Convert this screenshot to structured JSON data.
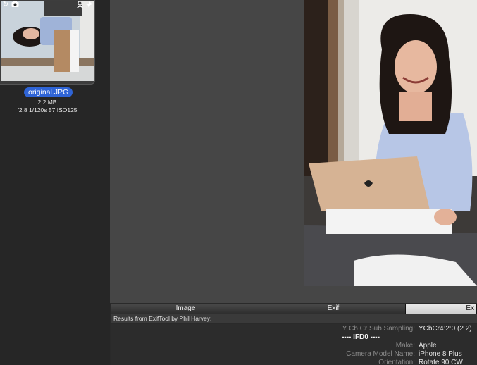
{
  "sidebar": {
    "file_name": "original.JPG",
    "file_size": "2.2 MB",
    "exposure": "f2.8 1/120s 57 ISO125",
    "thumb_icons": [
      "rotate-icon",
      "camera-icon",
      "person-icon",
      "pin-icon"
    ]
  },
  "tabs": [
    {
      "label": "Image"
    },
    {
      "label": "Exif"
    },
    {
      "label": "Ex"
    }
  ],
  "results": {
    "header": "Results from ExifTool by Phil Harvey:",
    "rows": [
      {
        "key": "Y Cb Cr Sub Sampling:",
        "value": "YCbCr4:2:0 (2 2)"
      },
      {
        "section": "---- IFD0 ----"
      },
      {
        "key": "Make:",
        "value": "Apple"
      },
      {
        "key": "Camera Model Name:",
        "value": "iPhone 8 Plus"
      },
      {
        "key": "Orientation:",
        "value": "Rotate 90 CW"
      }
    ]
  },
  "colors": {
    "accent": "#2f64d6",
    "sidebar_bg": "#262626",
    "main_bg": "#464646"
  }
}
